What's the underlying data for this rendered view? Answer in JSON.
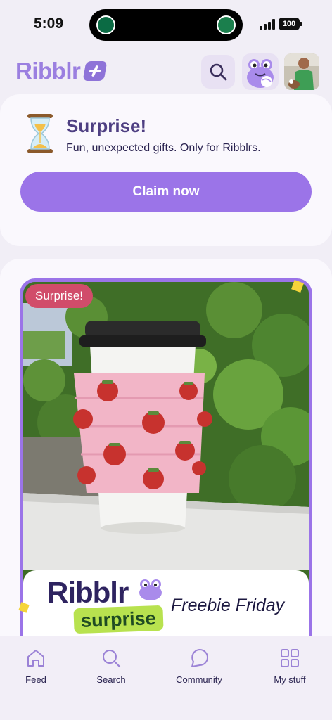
{
  "status_bar": {
    "time": "5:09",
    "battery": "100"
  },
  "header": {
    "logo": "Ribblr"
  },
  "surprise_card": {
    "title": "Surprise!",
    "subtitle": "Fun, unexpected gifts. Only for Ribblrs.",
    "button": "Claim now"
  },
  "feed": {
    "badge": "Surprise!",
    "banner_logo": "Ribblr",
    "banner_tag": "surprise",
    "banner_text": "Freebie Friday"
  },
  "nav": [
    {
      "label": "Feed",
      "icon": "home-icon"
    },
    {
      "label": "Search",
      "icon": "search-icon"
    },
    {
      "label": "Community",
      "icon": "chat-icon"
    },
    {
      "label": "My stuff",
      "icon": "grid-icon"
    }
  ],
  "colors": {
    "accent": "#9B74E8",
    "brand": "#4E3F82",
    "badge": "#D14C6A",
    "tag": "#B8E24F"
  }
}
